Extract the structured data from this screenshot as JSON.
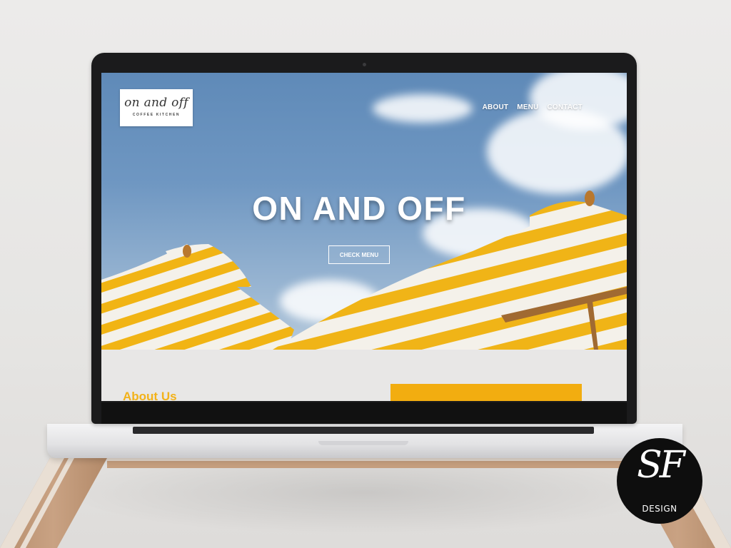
{
  "site": {
    "logo": {
      "main": "on and off",
      "sub": "COFFEE KITCHEN"
    },
    "nav": [
      "ABOUT",
      "MENU",
      "CONTACT"
    ],
    "hero": {
      "title": "ON AND OFF",
      "button": "CHECK MENU"
    },
    "about": {
      "title": "About Us"
    }
  },
  "badge": {
    "monogram": "SF",
    "label": "DESIGN"
  },
  "colors": {
    "accent": "#f2ad10",
    "sky": "#6f97c2",
    "laptop": "#1b1b1c"
  }
}
